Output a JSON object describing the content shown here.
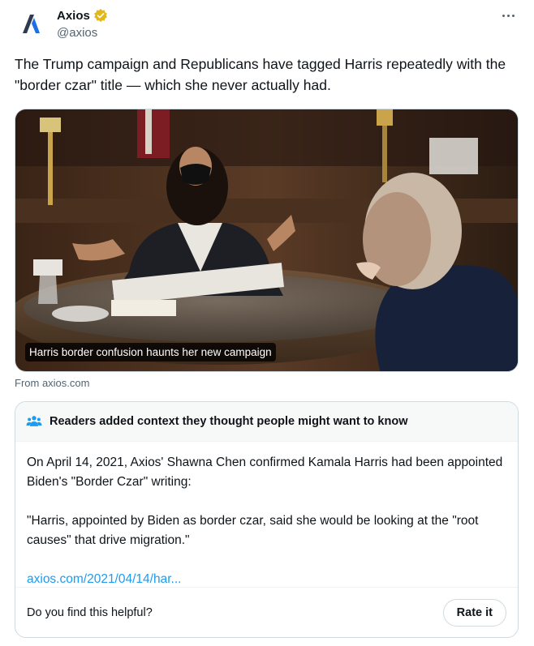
{
  "author": {
    "display_name": "Axios",
    "handle": "@axios",
    "verified_color": "#e2b719",
    "logo_icon": "axios-logo-icon"
  },
  "tweet": {
    "text": "The Trump campaign and Republicans have tagged Harris repeatedly with the \"border czar\" title — which she never actually had."
  },
  "media": {
    "caption": "Harris border confusion haunts her new campaign",
    "source": "From axios.com"
  },
  "community_note": {
    "header": "Readers added context they thought people might want to know",
    "paragraph1": "On April 14, 2021, Axios' Shawna Chen confirmed Kamala Harris had been appointed Biden's \"Border Czar\" writing:",
    "paragraph2": "\"Harris, appointed by Biden as border czar, said she would be looking at the \"root causes\" that drive migration.\"",
    "link": "axios.com/2021/04/14/har...",
    "helpful_prompt": "Do you find this helpful?",
    "rate_label": "Rate it",
    "icon": "people-icon",
    "accent_color": "#1d9bf0"
  }
}
